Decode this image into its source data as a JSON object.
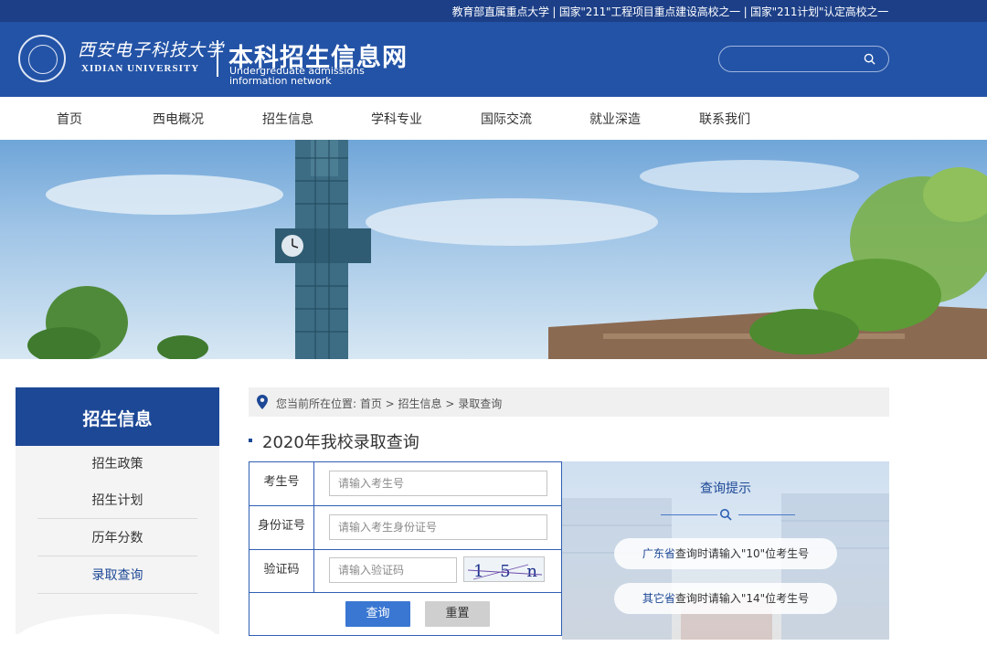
{
  "topbar": {
    "text": "教育部直属重点大学 | 国家\"211\"工程项目重点建设高校之一 | 国家\"211计划\"认定高校之一"
  },
  "header": {
    "logo_cn": "西安电子科技大学",
    "logo_en": "XIDIAN UNIVERSITY",
    "site_title": "本科招生信息网",
    "site_subtitle_line1": "Undergreduate admissions",
    "site_subtitle_line2": "information network",
    "search_value": ""
  },
  "nav": {
    "items": [
      {
        "label": "首页"
      },
      {
        "label": "西电概况"
      },
      {
        "label": "招生信息"
      },
      {
        "label": "学科专业"
      },
      {
        "label": "国际交流"
      },
      {
        "label": "就业深造"
      },
      {
        "label": "联系我们"
      }
    ]
  },
  "sidebar": {
    "title": "招生信息",
    "items": [
      {
        "label": "招生政策",
        "active": false
      },
      {
        "label": "招生计划",
        "active": false
      },
      {
        "label": "历年分数",
        "active": false
      },
      {
        "label": "录取查询",
        "active": true
      }
    ]
  },
  "breadcrumb": {
    "text": "您当前所在位置: 首页 > 招生信息 > 录取查询"
  },
  "page": {
    "title": "2020年我校录取查询"
  },
  "form": {
    "exam_no": {
      "label": "考生号",
      "placeholder": "请输入考生号",
      "value": ""
    },
    "id_no": {
      "label": "身份证号",
      "placeholder": "请输入考生身份证号",
      "value": ""
    },
    "captcha": {
      "label": "验证码",
      "placeholder": "请输入验证码",
      "value": "",
      "image_text": "1 5 n"
    },
    "query_label": "查询",
    "reset_label": "重置"
  },
  "tips": {
    "title": "查询提示",
    "line1_highlight": "广东省",
    "line1_rest": "查询时请输入\"10\"位考生号",
    "line2_highlight": "其它省",
    "line2_rest": "查询时请输入\"14\"位考生号"
  },
  "colors": {
    "topbar": "#1c3f87",
    "header": "#2353a6",
    "sidebar_head": "#1d4896",
    "form_border": "#2f5fb3",
    "query_button": "#3a77d2",
    "reset_button": "#cfcfcf"
  }
}
